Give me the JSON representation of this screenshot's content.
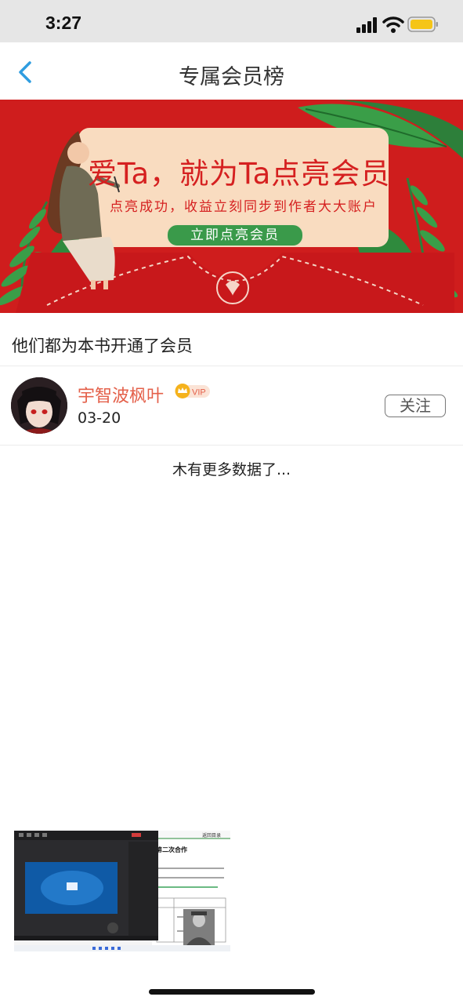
{
  "status_bar": {
    "time": "3:27",
    "signal_icon": "signal-bars-icon",
    "wifi_icon": "wifi-icon",
    "battery_icon": "battery-icon",
    "battery_color": "#f5c518"
  },
  "nav": {
    "title": "专属会员榜",
    "back_icon": "chevron-left-icon",
    "accent": "#2f9de0"
  },
  "banner": {
    "title": "爱Ta，就为Ta点亮会员",
    "subtitle": "点亮成功，收益立刻同步到作者大大账户",
    "button_label": "立即点亮会员"
  },
  "section": {
    "title": "他们都为本书开通了会员"
  },
  "members": [
    {
      "name": "宇智波枫叶",
      "badge": "VIP",
      "date": "03-20",
      "follow_label": "关注"
    }
  ],
  "footer": {
    "no_more_text": "木有更多数据了..."
  },
  "pip": {
    "doc_header": "返回目录",
    "doc_title": "第二次合作"
  }
}
